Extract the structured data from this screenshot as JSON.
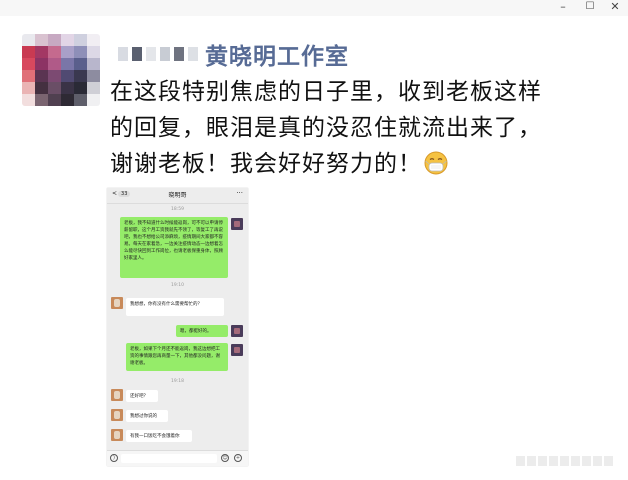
{
  "window": {
    "minimize_glyph": "–",
    "maximize_glyph": "☐",
    "close_glyph": "✕"
  },
  "post": {
    "author": "黄晓明工作室",
    "text_lines": [
      "在这段特别焦虑的日子里，收到老板这样",
      "的回复，眼泪是真的没忍住就流出来了，",
      "谢谢老板！我会好好努力的！"
    ],
    "emoji": "mask-face-icon"
  },
  "chat": {
    "back_count": "33",
    "title": "晓明哥",
    "more": "···",
    "time_1": "18:59",
    "time_2": "19:10",
    "time_3": "19:18",
    "messages": [
      {
        "side": "me",
        "text": "老板，我不知道什么时候能返岗，可不可以申请停薪留职，这个月工资我就先不领了，等复工了再说吧，我也不想给公司添麻烦，疫情期间大家都不容易。每天在家着急，一边关注疫情动态一边想着怎么能尽快回到工作岗位，也请老板保重身体，照顾好家里人。"
      },
      {
        "side": "boss",
        "text": "我想想，你有没有什么需要帮忙的？"
      },
      {
        "side": "me",
        "text": "嗯，都挺好的。"
      },
      {
        "side": "me",
        "text": "老板，如果下个月还不能返岗，我这边想把工资的事情跟您再商量一下，其他都没问题，谢谢老板。"
      },
      {
        "side": "boss",
        "text": "还好吧？"
      },
      {
        "side": "boss",
        "text": "我想过你说的"
      },
      {
        "side": "boss",
        "text": "有我一口饭吃不会饿着你"
      }
    ]
  },
  "colors": {
    "author_link": "#576b95",
    "bubble_green": "#95ec69",
    "chat_bg": "#ededed"
  }
}
